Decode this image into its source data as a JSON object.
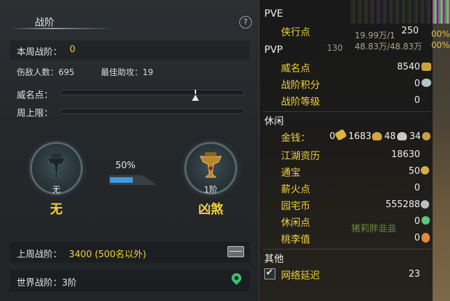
{
  "left": {
    "title": "战阶",
    "help": "?",
    "weekly_rank_label": "本周战阶：",
    "weekly_rank_value": "0",
    "kills_label": "伤敌人数：695",
    "best_assist_label": "最佳助攻：19",
    "prestige_label": "威名点：",
    "weekly_cap_label": "周上限：",
    "badge_left": {
      "under": "无",
      "name": "无"
    },
    "badge_right": {
      "under": "1阶",
      "name": "凶煞"
    },
    "progress": {
      "text": "50%",
      "value": 0.5
    },
    "last_week_label": "上周战阶：",
    "last_week_value": "3400 (500名以外)",
    "world_rank_label": "世界战阶：3阶"
  },
  "right": {
    "pve": {
      "section": "PVE",
      "xiaxing_label": "侠行点",
      "xiaxing_value": "250"
    },
    "pvp": {
      "section": "PVP",
      "weiming_label": "威名点",
      "weiming_value": "8540",
      "zhanjie_points_label": "战阶积分",
      "zhanjie_points_value": "0",
      "zhanjie_level_label": "战阶等级",
      "zhanjie_level_value": "0"
    },
    "leisure": {
      "section": "休闲",
      "money_label": "金钱：",
      "money_v1": "0",
      "money_v2": "1683",
      "money_v3": "48",
      "money_v4": "34",
      "jianghu_label": "江湖资历",
      "jianghu_value": "18630",
      "tongbao_label": "通宝",
      "tongbao_value": "50",
      "xinhuo_label": "薪火点",
      "xinhuo_value": "0",
      "yuanzhai_label": "园宅币",
      "yuanzhai_value": "555288",
      "xiuxian_label": "休闲点",
      "xiuxian_value": "0",
      "taoli_label": "桃李值",
      "taoli_value": "0"
    },
    "other": {
      "section": "其他",
      "latency_label": "网络延迟",
      "latency_value": "23",
      "latency_checked": true
    },
    "hud": {
      "hp1": "19.99万/1",
      "hp1b": "00%",
      "hp2": "48.83万/48.83万",
      "hp2b": "00%",
      "lvl": "130",
      "npc": "猪莉胖韭韭"
    }
  }
}
